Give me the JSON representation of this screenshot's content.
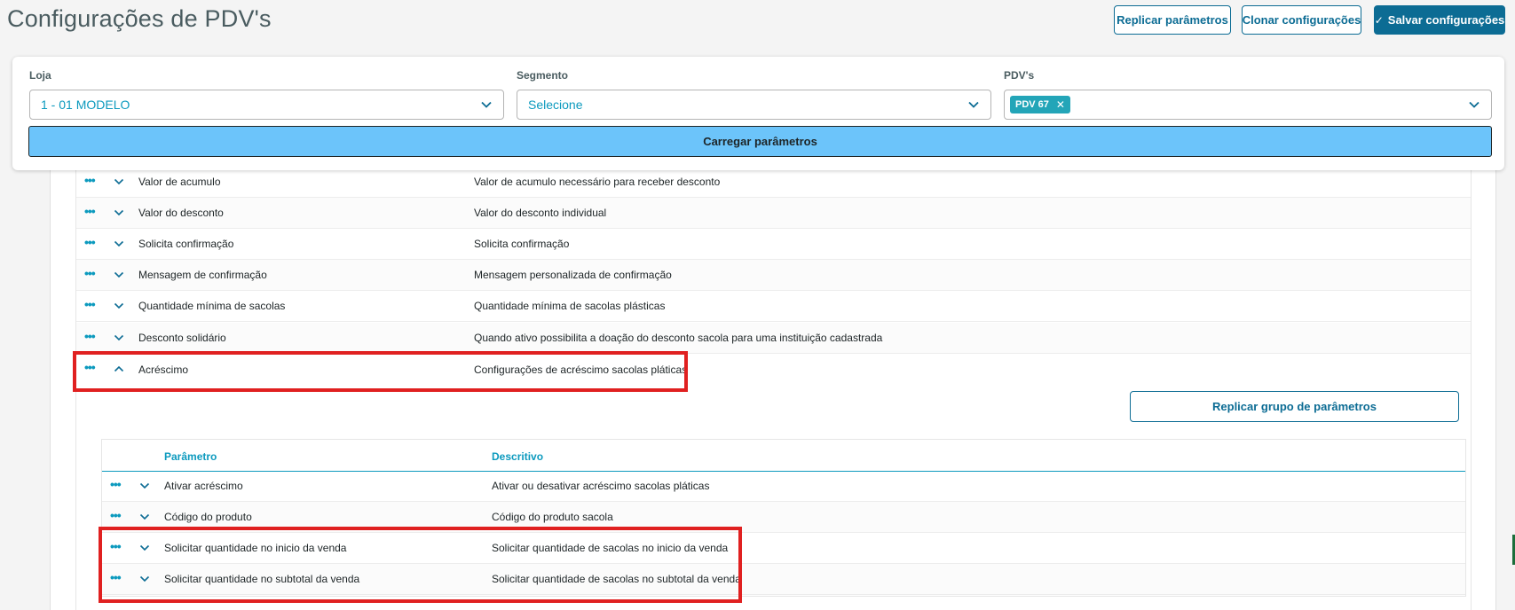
{
  "header": {
    "title": "Configurações de PDV's",
    "replicar_label": "Replicar parâmetros",
    "clonar_label": "Clonar configurações",
    "salvar_label": "Salvar configurações"
  },
  "filters": {
    "loja": {
      "label": "Loja",
      "value": "1 - 01 MODELO"
    },
    "segmento": {
      "label": "Segmento",
      "value": "Selecione"
    },
    "pdvs": {
      "label": "PDV's",
      "tags": [
        "PDV 67"
      ]
    },
    "load_label": "Carregar parâmetros"
  },
  "parameters": [
    {
      "name": "Valor de acumulo",
      "desc": "Valor de acumulo necessário para receber desconto",
      "expanded": false
    },
    {
      "name": "Valor do desconto",
      "desc": "Valor do desconto individual",
      "expanded": false
    },
    {
      "name": "Solicita confirmação",
      "desc": "Solicita confirmação",
      "expanded": false
    },
    {
      "name": "Mensagem de confirmação",
      "desc": "Mensagem personalizada de confirmação",
      "expanded": false
    },
    {
      "name": "Quantidade mínima de sacolas",
      "desc": "Quantidade mínima de sacolas plásticas",
      "expanded": false
    },
    {
      "name": "Desconto solidário",
      "desc": "Quando ativo possibilita a doação do desconto sacola para uma instituição cadastrada",
      "expanded": false
    },
    {
      "name": "Acréscimo",
      "desc": "Configurações de acréscimo sacolas pláticas",
      "expanded": true
    }
  ],
  "group": {
    "replicar_group_label": "Replicar grupo de parâmetros",
    "columns": {
      "param": "Parâmetro",
      "desc": "Descritivo"
    },
    "rows": [
      {
        "name": "Ativar acréscimo",
        "desc": "Ativar ou desativar acréscimo sacolas pláticas"
      },
      {
        "name": "Código do produto",
        "desc": "Código do produto sacola"
      },
      {
        "name": "Solicitar quantidade no inicio da venda",
        "desc": "Solicitar quantidade de sacolas no inicio da venda"
      },
      {
        "name": "Solicitar quantidade no subtotal da venda",
        "desc": "Solicitar quantidade de sacolas no subtotal da venda"
      }
    ]
  },
  "icons": {
    "more": "more-dots-icon",
    "expand": "chevron-down-icon",
    "collapse": "chevron-up-icon",
    "check": "check-icon",
    "remove_tag": "close-icon"
  },
  "colors": {
    "primary": "#0c6c94",
    "accent": "#0c9abe",
    "load_button": "#6cc4fa",
    "tag": "#23a5b8",
    "highlight": "#e02020"
  }
}
